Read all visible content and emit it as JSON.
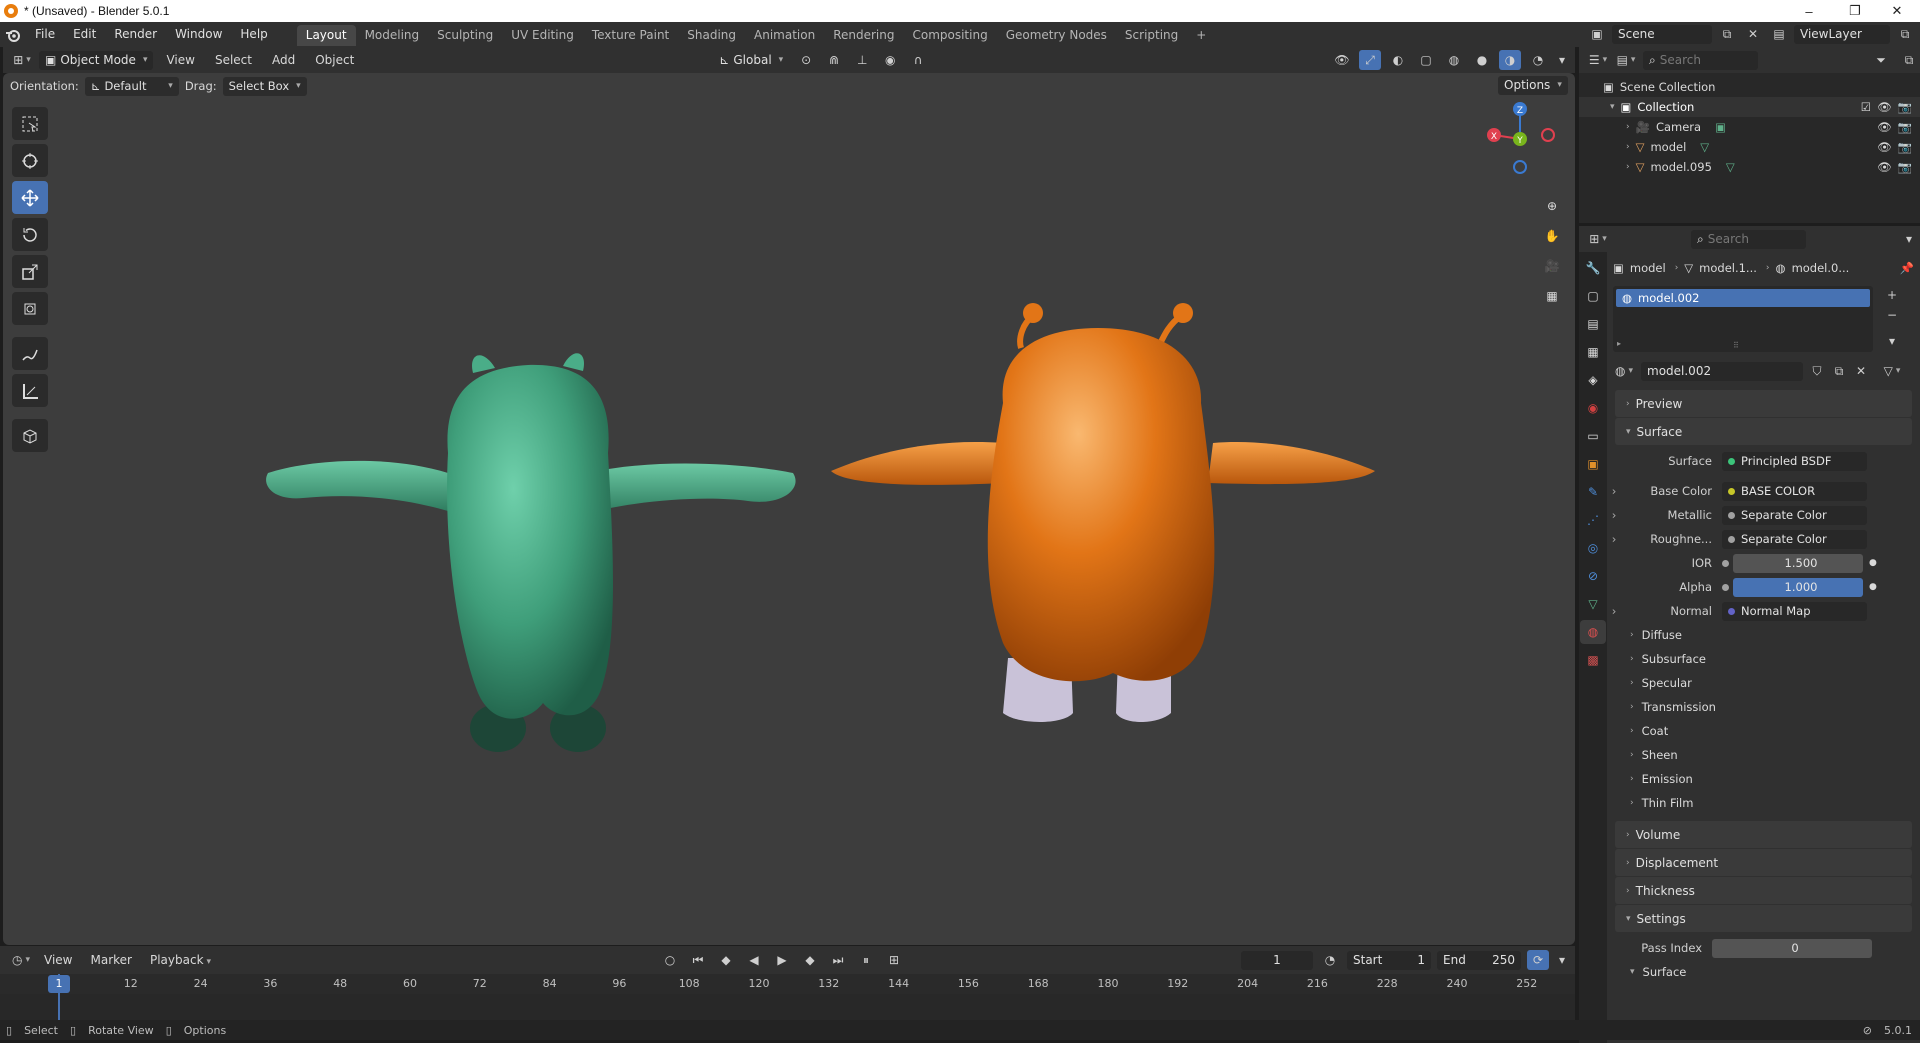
{
  "window": {
    "title": "* (Unsaved) - Blender 5.0.1",
    "minimize": "–",
    "maximize": "❐",
    "close": "✕"
  },
  "menu": [
    "File",
    "Edit",
    "Render",
    "Window",
    "Help"
  ],
  "workspaces": [
    "Layout",
    "Modeling",
    "Sculpting",
    "UV Editing",
    "Texture Paint",
    "Shading",
    "Animation",
    "Rendering",
    "Compositing",
    "Geometry Nodes",
    "Scripting"
  ],
  "workspace_add": "+",
  "scene": {
    "name": "Scene",
    "view_layer": "ViewLayer"
  },
  "viewport_header": {
    "mode": "Object Mode",
    "menus": [
      "View",
      "Select",
      "Add",
      "Object"
    ],
    "transform": "Global"
  },
  "tool_settings": {
    "orientation_label": "Orientation:",
    "orientation": "Default",
    "drag_label": "Drag:",
    "drag": "Select Box",
    "options": "Options"
  },
  "outliner": {
    "search_placeholder": "Search",
    "root": "Scene Collection",
    "collection": "Collection",
    "items": [
      "Camera",
      "model",
      "model.095"
    ]
  },
  "properties": {
    "search_placeholder": "Search",
    "breadcrumb": [
      "model",
      "model.1...",
      "model.0..."
    ],
    "slot": "model.002",
    "material_name": "model.002",
    "panels": {
      "preview": "Preview",
      "surface": "Surface",
      "volume": "Volume",
      "displacement": "Displacement",
      "thickness": "Thickness",
      "settings": "Settings",
      "surface_sub": "Surface"
    },
    "surface_label": "Surface",
    "surface_shader": "Principled BSDF",
    "inputs": [
      {
        "label": "Base Color",
        "value": "BASE COLOR",
        "dot": "#c7c729"
      },
      {
        "label": "Metallic",
        "value": "Separate Color",
        "dot": "#a1a1a1"
      },
      {
        "label": "Roughne...",
        "value": "Separate Color",
        "dot": "#a1a1a1"
      }
    ],
    "ior": {
      "label": "IOR",
      "value": "1.500"
    },
    "alpha": {
      "label": "Alpha",
      "value": "1.000"
    },
    "normal": {
      "label": "Normal",
      "value": "Normal Map"
    },
    "subpanels": [
      "Diffuse",
      "Subsurface",
      "Specular",
      "Transmission",
      "Coat",
      "Sheen",
      "Emission",
      "Thin Film"
    ],
    "pass_index": {
      "label": "Pass Index",
      "value": "0"
    }
  },
  "timeline": {
    "menus": [
      "View",
      "Marker",
      "Playback"
    ],
    "current_frame": "1",
    "start_label": "Start",
    "start": "1",
    "end_label": "End",
    "end": "250",
    "ticks": [
      "1",
      "12",
      "24",
      "36",
      "48",
      "60",
      "72",
      "84",
      "96",
      "108",
      "120",
      "132",
      "144",
      "156",
      "168",
      "180",
      "192",
      "204",
      "216",
      "228",
      "240",
      "252"
    ]
  },
  "statusbar": {
    "select": "Select",
    "rotate": "Rotate View",
    "options": "Options",
    "version": "5.0.1"
  },
  "colors": {
    "accent": "#4772b3",
    "green_model": "#3f9e7a",
    "orange_model": "#e27517",
    "x_axis": "#e0404f",
    "y_axis": "#79b51c",
    "z_axis": "#3a7ad1"
  }
}
